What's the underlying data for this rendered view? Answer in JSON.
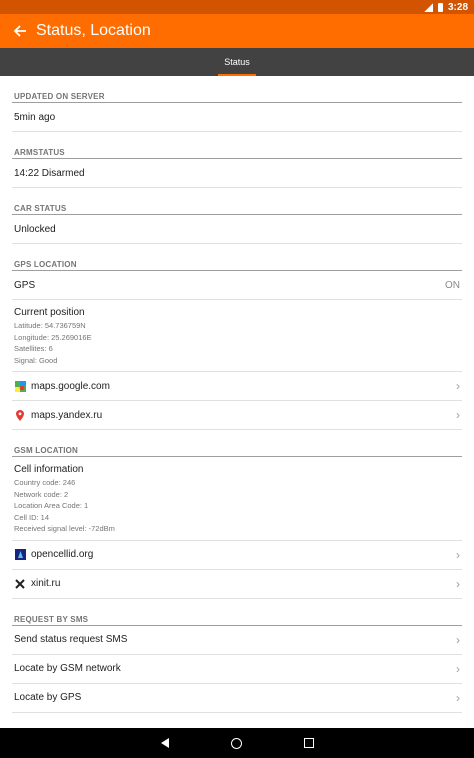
{
  "statusbar": {
    "time": "3:28"
  },
  "appbar": {
    "title": "Status, Location",
    "back_icon": "arrow-back-icon"
  },
  "tabs": [
    {
      "label": "Status"
    }
  ],
  "sections": {
    "updated": {
      "header": "UPDATED ON SERVER",
      "value": "5min ago"
    },
    "armstatus": {
      "header": "ARMSTATUS",
      "value": "14:22 Disarmed"
    },
    "car": {
      "header": "CAR STATUS",
      "value": "Unlocked"
    },
    "gps": {
      "header": "GPS LOCATION",
      "gps_label": "GPS",
      "gps_value": "ON",
      "position_title": "Current position",
      "position_lines": [
        "Latitude: 54.736759N",
        "Longitude: 25.269016E",
        "Satellites: 6",
        "Signal: Good"
      ],
      "links": [
        {
          "label": "maps.google.com",
          "icon": "google-maps-icon"
        },
        {
          "label": "maps.yandex.ru",
          "icon": "yandex-pin-icon"
        }
      ]
    },
    "gsm": {
      "header": "GSM LOCATION",
      "cell_title": "Cell information",
      "cell_lines": [
        "Country code: 246",
        "Network code: 2",
        "Location Area Code: 1",
        "Cell ID: 14",
        "Received signal level: -72dBm"
      ],
      "links": [
        {
          "label": "opencellid.org",
          "icon": "opencellid-icon"
        },
        {
          "label": "xinit.ru",
          "icon": "xinit-icon"
        }
      ]
    },
    "sms": {
      "header": "REQUEST BY SMS",
      "items": [
        {
          "label": "Send status request SMS"
        },
        {
          "label": "Locate by GSM network"
        },
        {
          "label": "Locate by GPS"
        }
      ]
    }
  },
  "colors": {
    "accent": "#ff6d00",
    "statusbar": "#d35400",
    "tabbar": "#424242"
  }
}
